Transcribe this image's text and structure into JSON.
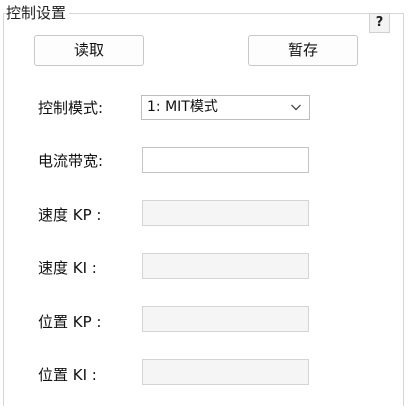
{
  "group": {
    "title": "控制设置",
    "help_label": "?"
  },
  "toolbar": {
    "read_label": "读取",
    "save_label": "暂存"
  },
  "form": {
    "mode": {
      "label": "控制模式:",
      "selected": "1: MIT模式"
    },
    "current_bandwidth": {
      "label": "电流带宽:",
      "value": ""
    },
    "speed_kp": {
      "label": "速度 KP :",
      "value": ""
    },
    "speed_ki": {
      "label": "速度 KI :",
      "value": ""
    },
    "position_kp": {
      "label": "位置 KP :",
      "value": ""
    },
    "position_ki": {
      "label": "位置 KI :",
      "value": ""
    }
  },
  "icons": {
    "dropdown": "chevron-down-icon",
    "help": "question-mark-icon"
  },
  "colors": {
    "border": "#c4c4c4",
    "disabled_field": "#f5f5f5",
    "text": "#111111"
  }
}
